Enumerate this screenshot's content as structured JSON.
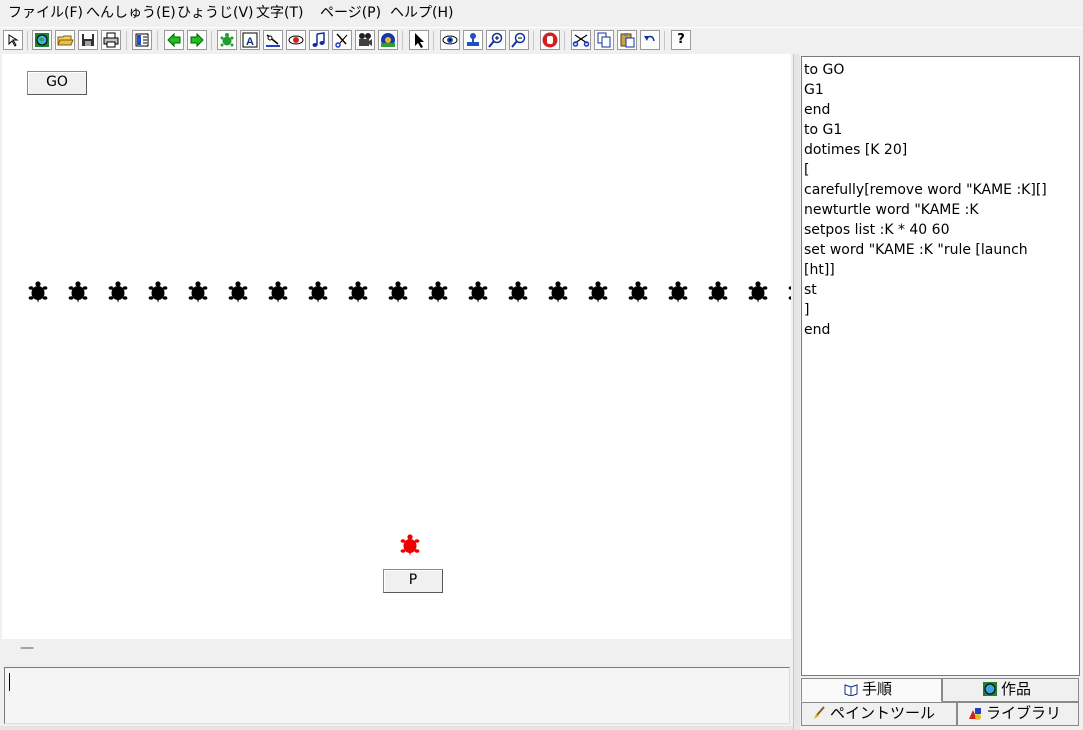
{
  "menubar": {
    "items": [
      "ファイル(F)",
      "へんしゅう(E)",
      "ひょうじ(V)",
      "文字(T)",
      "ページ(P)",
      "ヘルプ(H)"
    ]
  },
  "toolbar": {
    "icons": [
      "cursor-icon",
      "globe-icon",
      "folder-open-icon",
      "save-icon",
      "print-icon",
      "layout-icon",
      "arrow-left-icon",
      "arrow-right-icon",
      "turtle-icon",
      "text-box-icon",
      "slider-icon",
      "shape-icon",
      "music-icon",
      "scissors-icon",
      "video-icon",
      "record-icon",
      "pointer-icon",
      "eye-icon",
      "stamp-icon",
      "zoom-in-icon",
      "zoom-out-icon",
      "stop-hand-icon",
      "cut-icon",
      "copy-icon",
      "paste-icon",
      "undo-icon",
      "help-icon"
    ],
    "help_label": "?"
  },
  "canvas": {
    "go_button": "GO",
    "p_button": "P",
    "turtle_row_count": 20,
    "turtle_color": "#000000",
    "red_turtle_color": "#ee0000"
  },
  "footer": {
    "dash": "—"
  },
  "procedures": {
    "lines": [
      "to GO",
      "G1",
      "end",
      "to G1",
      "dotimes [K 20]",
      "[",
      "carefully[remove word \"KAME :K][]",
      "newturtle word \"KAME :K",
      "setpos list :K * 40 60",
      "set word \"KAME :K \"rule [launch",
      "[ht]]",
      "st",
      "]",
      "end"
    ]
  },
  "tabs": {
    "procedures": "手順",
    "projects": "作品",
    "paint": "ペイントツール",
    "library": "ライブラリ"
  }
}
